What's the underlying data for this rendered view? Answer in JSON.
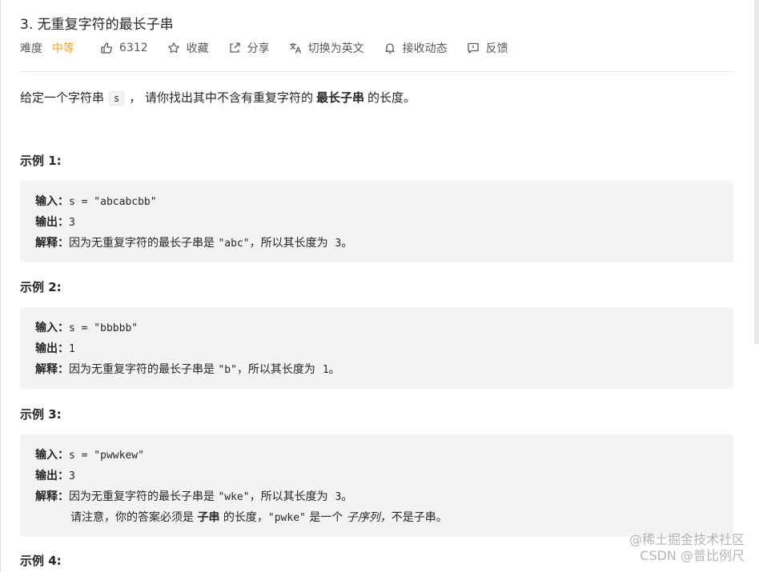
{
  "problem": {
    "title": "3. 无重复字符的最长子串",
    "difficulty_label": "难度",
    "difficulty": "中等",
    "likes": "6312",
    "favorite": "收藏",
    "share": "分享",
    "switch_lang": "切换为英文",
    "notify": "接收动态",
    "feedback": "反馈"
  },
  "description": {
    "pre": "给定一个字符串",
    "code": "s",
    "mid": "，  请你找出其中不含有重复字符的",
    "bold": "最长子串",
    "post": "的长度。"
  },
  "examples": [
    {
      "title": "示例 1:",
      "input_label": "输入：",
      "input": "s = \"abcabcbb\"",
      "output_label": "输出：",
      "output": "3",
      "explain_label": "解释：",
      "explain_pre": "因为无重复字符的最长子串是",
      "explain_code": "\"abc\"",
      "explain_post": "，所以其长度为",
      "explain_num": "3",
      "explain_end": "。"
    },
    {
      "title": "示例 2:",
      "input_label": "输入：",
      "input": "s = \"bbbbb\"",
      "output_label": "输出：",
      "output": "1",
      "explain_label": "解释：",
      "explain_pre": "因为无重复字符的最长子串是",
      "explain_code": "\"b\"",
      "explain_post": "，所以其长度为",
      "explain_num": "1",
      "explain_end": "。"
    },
    {
      "title": "示例 3:",
      "input_label": "输入：",
      "input": "s = \"pwwkew\"",
      "output_label": "输出：",
      "output": "3",
      "explain_label": "解释：",
      "explain_pre": "因为无重复字符的最长子串是",
      "explain_code": "\"wke\"",
      "explain_post": "，所以其长度为",
      "explain_num": "3",
      "explain_end": "。",
      "note_pre": "请注意，你的答案必须是",
      "note_bold": "子串",
      "note_mid": "的长度，",
      "note_code": "\"pwke\"",
      "note_mid2": "是一个",
      "note_italic": "子序列，",
      "note_post": "不是子串。"
    },
    {
      "title": "示例 4:"
    }
  ],
  "watermark": {
    "line1": "@稀土掘金技术社区",
    "line2": "CSDN @普比例尺"
  }
}
